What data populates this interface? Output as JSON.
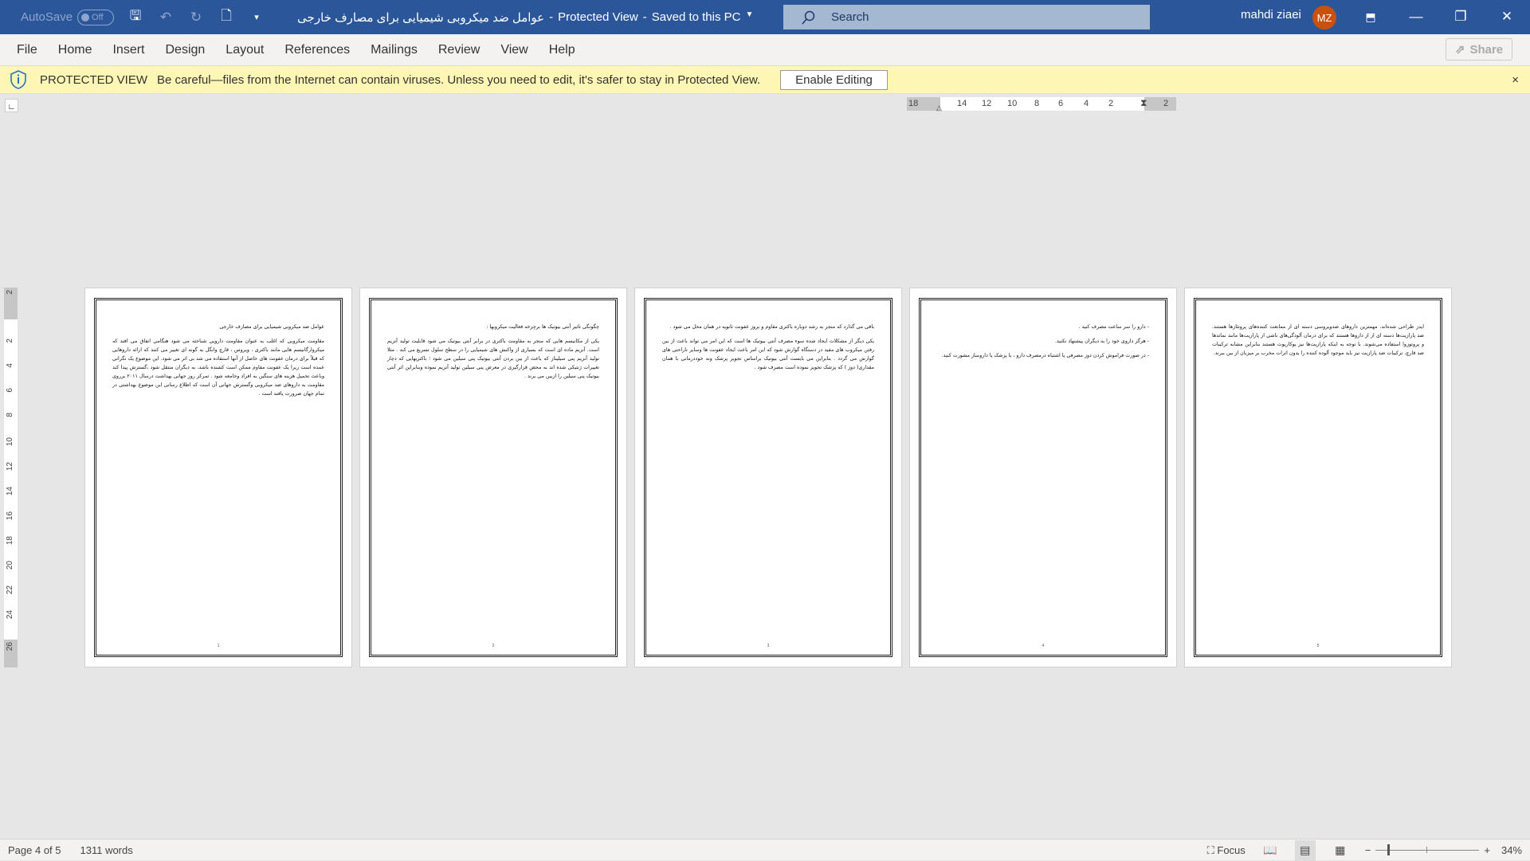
{
  "titlebar": {
    "autosave_label": "AutoSave",
    "autosave_state": "Off",
    "doc_name": "عوامل ضد میکروبی شیمیایی برای مصارف خارجی",
    "sep1": "-",
    "mode": "Protected View",
    "sep2": "-",
    "save_status": "Saved to this PC",
    "search_placeholder": "Search",
    "user_name": "mahdi ziaei",
    "user_initials": "MZ",
    "avatar_color": "#c9510c",
    "accent": "#2b579a"
  },
  "menu": {
    "items": [
      "File",
      "Home",
      "Insert",
      "Design",
      "Layout",
      "References",
      "Mailings",
      "Review",
      "View",
      "Help"
    ],
    "share_label": "Share"
  },
  "protected_view": {
    "label": "PROTECTED VIEW",
    "message": "Be careful—files from the Internet can contain viruses. Unless you need to edit, it's safer to stay in Protected View.",
    "button": "Enable Editing",
    "close": "×"
  },
  "ruler": {
    "h_ticks": [
      "18",
      "14",
      "12",
      "10",
      "8",
      "6",
      "4",
      "2",
      "2"
    ],
    "v_ticks": [
      "2",
      "2",
      "4",
      "6",
      "8",
      "10",
      "12",
      "14",
      "16",
      "18",
      "20",
      "22",
      "24",
      "26"
    ]
  },
  "pages": [
    {
      "number": "1",
      "paragraphs": [
        "عوامل ضد میکروبی شیمیایی برای مصارف خارجی",
        "مقاومت میکروبی که اغلب به عنوان مقاومت دارویی شناخته می شود هنگامی اتفاق می افتد که میکروارگانیسم هایی مانند باکتری ، ویروس ، قارچ وانگل به گونه ای تغییر می کنند که ارائه داروهایی که قبلاً برای درمان عفونت های حاصل از آنها استفاده می شد بی اثر می شود. این موضوع یک نگرانی عمده است زیرا یک عفونت مقاوم ممکن است کشنده باشد، به دیگران منتقل شود ،گسترش پیدا کند وباعث تحمیل هزینه های سنگین به افراد وجامعه شود . تمرکز روز جهانی بهداشت درسال ۲۰۱۱ برروی مقاومت به داروهای ضد میکروبی وگسترش جهانی آن است که اطلاع رسانی این موضوع بهداشتی در تمام جهان ضرورت یافته است ."
      ]
    },
    {
      "number": "2",
      "paragraphs": [
        "چگونگی تاثیر آنتی بیوتیک ها برچرخه فعالیت میکروبها :",
        "یکی از مکانیسم هایی که منجر به مقاومت باکتری در برابر آنتی بیوتیک می شود قابلیت تولید آنزیم است. آنزیم ماده ای است که بسیاری از واکنش های شیمیایی را در سطح سلول تسریع می کند . مثلا تولید آنزیم پنی سیلیناز که باعث از بین بردن آنتی بیوتیک پنی سیلین می شود ؛ باکتریهایی که دچار تغییرات ژنتیکی شده اند به محض قرارگیری در معرض پنی سیلین تولید آنزیم نموده وبنابراین اثر آنتی بیوتیک پنی سیلین را ازبین می برند ."
      ]
    },
    {
      "number": "3",
      "paragraphs": [
        "باقی می گذارد که منجر به رشد دوباره باکتری مقاوم و بروز عفونت ثانویه در همان محل می شود .",
        "یکی دیگر از مشکلات ایجاد شده سوء مصرف آنتی بیوتیک ها است که این امر می تواند باعث از بین رفتن میکروب های مفید در دستگاه گوارش شود که این امر باعث ایجاد عفونت ها وسایر ناراحتی های گوارش می گردد . بنابراین می بایست آنتی بیوتیک براساس تجویز پزشک ونه خوددرمانی با همان مقداری( دوز ) که پزشک تجویز نموده است مصرف شود ."
      ]
    },
    {
      "number": "4",
      "paragraphs": [
        "- دارو را سر ساعت مصرف کنید .",
        "- هرگز داروی خود را به دیگران پیشنهاد نکنید.",
        "- در صورت فراموش کردن دوز مصرفی یا اشتباه درمصرف دارو ، با پزشک یا داروساز مشورت کنید."
      ]
    },
    {
      "number": "5",
      "paragraphs": [
        "ایدز طراحی شده‌اند. مهمترین داروهای ضدویروسی دسته ای از ممانعت کننده‌های پروتئازها هستند. ضد پارازیت‌ها دسته ای از از داروها هستند که برای درمان آلودگی‌های ناشی از پارازیت‌ها مانند نماتدها و پروتوزوا استفاده می‌شوند. با توجه به اینکه پارازیت‌ها نیز یوکاریوت هستند بنابراین مشابه ترکیبات ضد قارچ، ترکیبات ضد پارازیت نیز باید موجود آلوده کننده را بدون اثرات مخرب بر میزبان از بین ببرند."
      ]
    }
  ],
  "status": {
    "page": "Page 4 of 5",
    "words": "1311 words",
    "focus": "Focus",
    "zoom_minus": "−",
    "zoom_plus": "+",
    "zoom_level": "34%",
    "zoom_percent": 34
  }
}
